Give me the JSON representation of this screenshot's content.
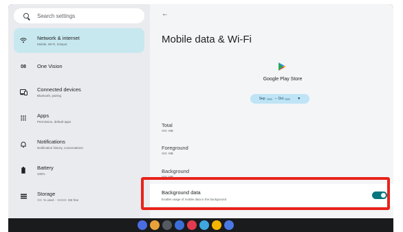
{
  "search": {
    "placeholder": "Search settings"
  },
  "sidebar": {
    "items": [
      {
        "title": "Network & internet",
        "subtitle": "Mobile, Wi-Fi, hotspot",
        "icon": "wifi-icon",
        "active": true
      },
      {
        "title": "One Vision",
        "subtitle": "",
        "icon": "one-vision-icon"
      },
      {
        "title": "Connected devices",
        "subtitle": "Bluetooth, pairing",
        "icon": "devices-icon"
      },
      {
        "title": "Apps",
        "subtitle": "Permission, default apps",
        "icon": "apps-grid-icon"
      },
      {
        "title": "Notifications",
        "subtitle": "Notification history, conversations",
        "icon": "bell-icon"
      },
      {
        "title": "Battery",
        "subtitle": "100%",
        "icon": "battery-icon"
      },
      {
        "title": "Storage",
        "subtitle_pre": "% used - ",
        "subtitle_post": " GB free",
        "icon": "storage-icon"
      }
    ]
  },
  "main": {
    "back_icon": "back-arrow-icon",
    "title": "Mobile data & Wi-Fi",
    "app_name": "Google Play Store",
    "date_range": {
      "sep": "Sep",
      "dash": "–",
      "oct": "Oct"
    },
    "usage": [
      {
        "label": "Total",
        "unit": "MB"
      },
      {
        "label": "Foreground",
        "unit": "MB"
      },
      {
        "label": "Background",
        "unit": "MB"
      }
    ],
    "background_data": {
      "label": "Background data",
      "description": "Enable usage of mobile data in the background",
      "enabled": true
    }
  },
  "colors": {
    "accent": "#06757d",
    "highlight": "#e8221a",
    "active_item": "#c7e8ef",
    "date_pill": "#bfe4f6"
  },
  "taskbar": {
    "apps": [
      {
        "name": "cardboard-app-icon",
        "color": "#4a6ee0"
      },
      {
        "name": "chrome-icon",
        "color": "#e8a13a"
      },
      {
        "name": "camera-icon",
        "color": "#555a60"
      },
      {
        "name": "settings-icon",
        "color": "#3b6fd8"
      },
      {
        "name": "app-icon-red",
        "color": "#e23a4f"
      },
      {
        "name": "app-icon-multicolor",
        "color": "#3fa7e0"
      },
      {
        "name": "app-icon-dots",
        "color": "#f2b500"
      },
      {
        "name": "photos-icon",
        "color": "#4a78e4"
      }
    ]
  }
}
